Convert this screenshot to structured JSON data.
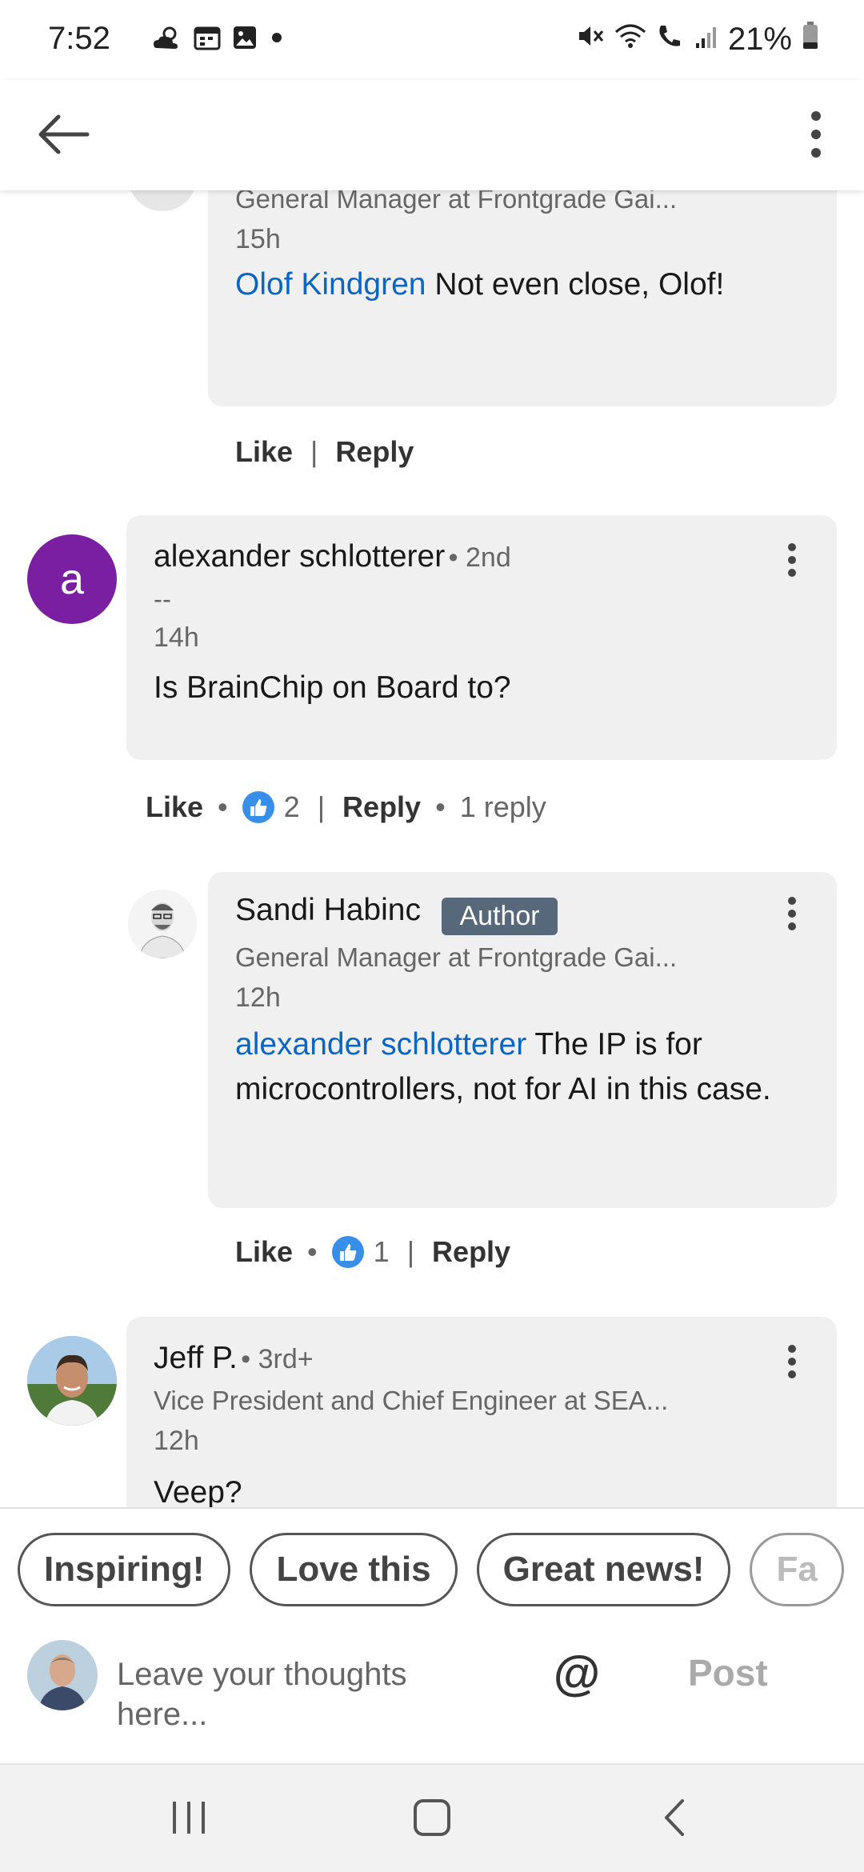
{
  "status_bar": {
    "time": "7:52",
    "battery": "21%",
    "left_icons": [
      "weather-icon",
      "calendar-icon",
      "image-icon",
      "dot-icon"
    ],
    "right_icons": [
      "mute-icon",
      "wifi-icon",
      "wifi-call-icon",
      "signal-icon",
      "battery-icon"
    ]
  },
  "comments": [
    {
      "id": "c0",
      "headline": "General Manager at Frontgrade Gai...",
      "time": "15h",
      "mention": "Olof Kindgren",
      "text": " Not even close, Olof!",
      "actions": {
        "like": "Like",
        "reply": "Reply"
      }
    },
    {
      "id": "c1",
      "avatar_letter": "a",
      "name": "alexander schlotterer",
      "degree": "• 2nd",
      "headline": "--",
      "time": "14h",
      "text": "Is BrainChip on Board to?",
      "actions": {
        "like": "Like",
        "like_count": "2",
        "reply": "Reply",
        "replies": "1 reply"
      }
    },
    {
      "id": "c2",
      "name": "Sandi Habinc",
      "badge": "Author",
      "headline": "General Manager at Frontgrade Gai...",
      "time": "12h",
      "mention": "alexander schlotterer",
      "text": " The IP is for microcontrollers, not for AI in this case.",
      "actions": {
        "like": "Like",
        "like_count": "1",
        "reply": "Reply"
      }
    },
    {
      "id": "c3",
      "name": "Jeff P.",
      "degree": "• 3rd+",
      "headline": "Vice President and Chief Engineer at SEA...",
      "time": "12h",
      "text": "Veep?"
    }
  ],
  "composer": {
    "chips": [
      "Inspiring!",
      "Love this",
      "Great news!",
      "Fa"
    ],
    "placeholder_line1": "Leave your thoughts",
    "placeholder_line2": "here...",
    "at_symbol": "@",
    "post_label": "Post"
  },
  "colors": {
    "mention": "#0a66c2",
    "bubble": "#f0f0f0",
    "avatar_purple": "#7b1fa2",
    "badge": "#56687a",
    "like_blue": "#378fe9"
  }
}
